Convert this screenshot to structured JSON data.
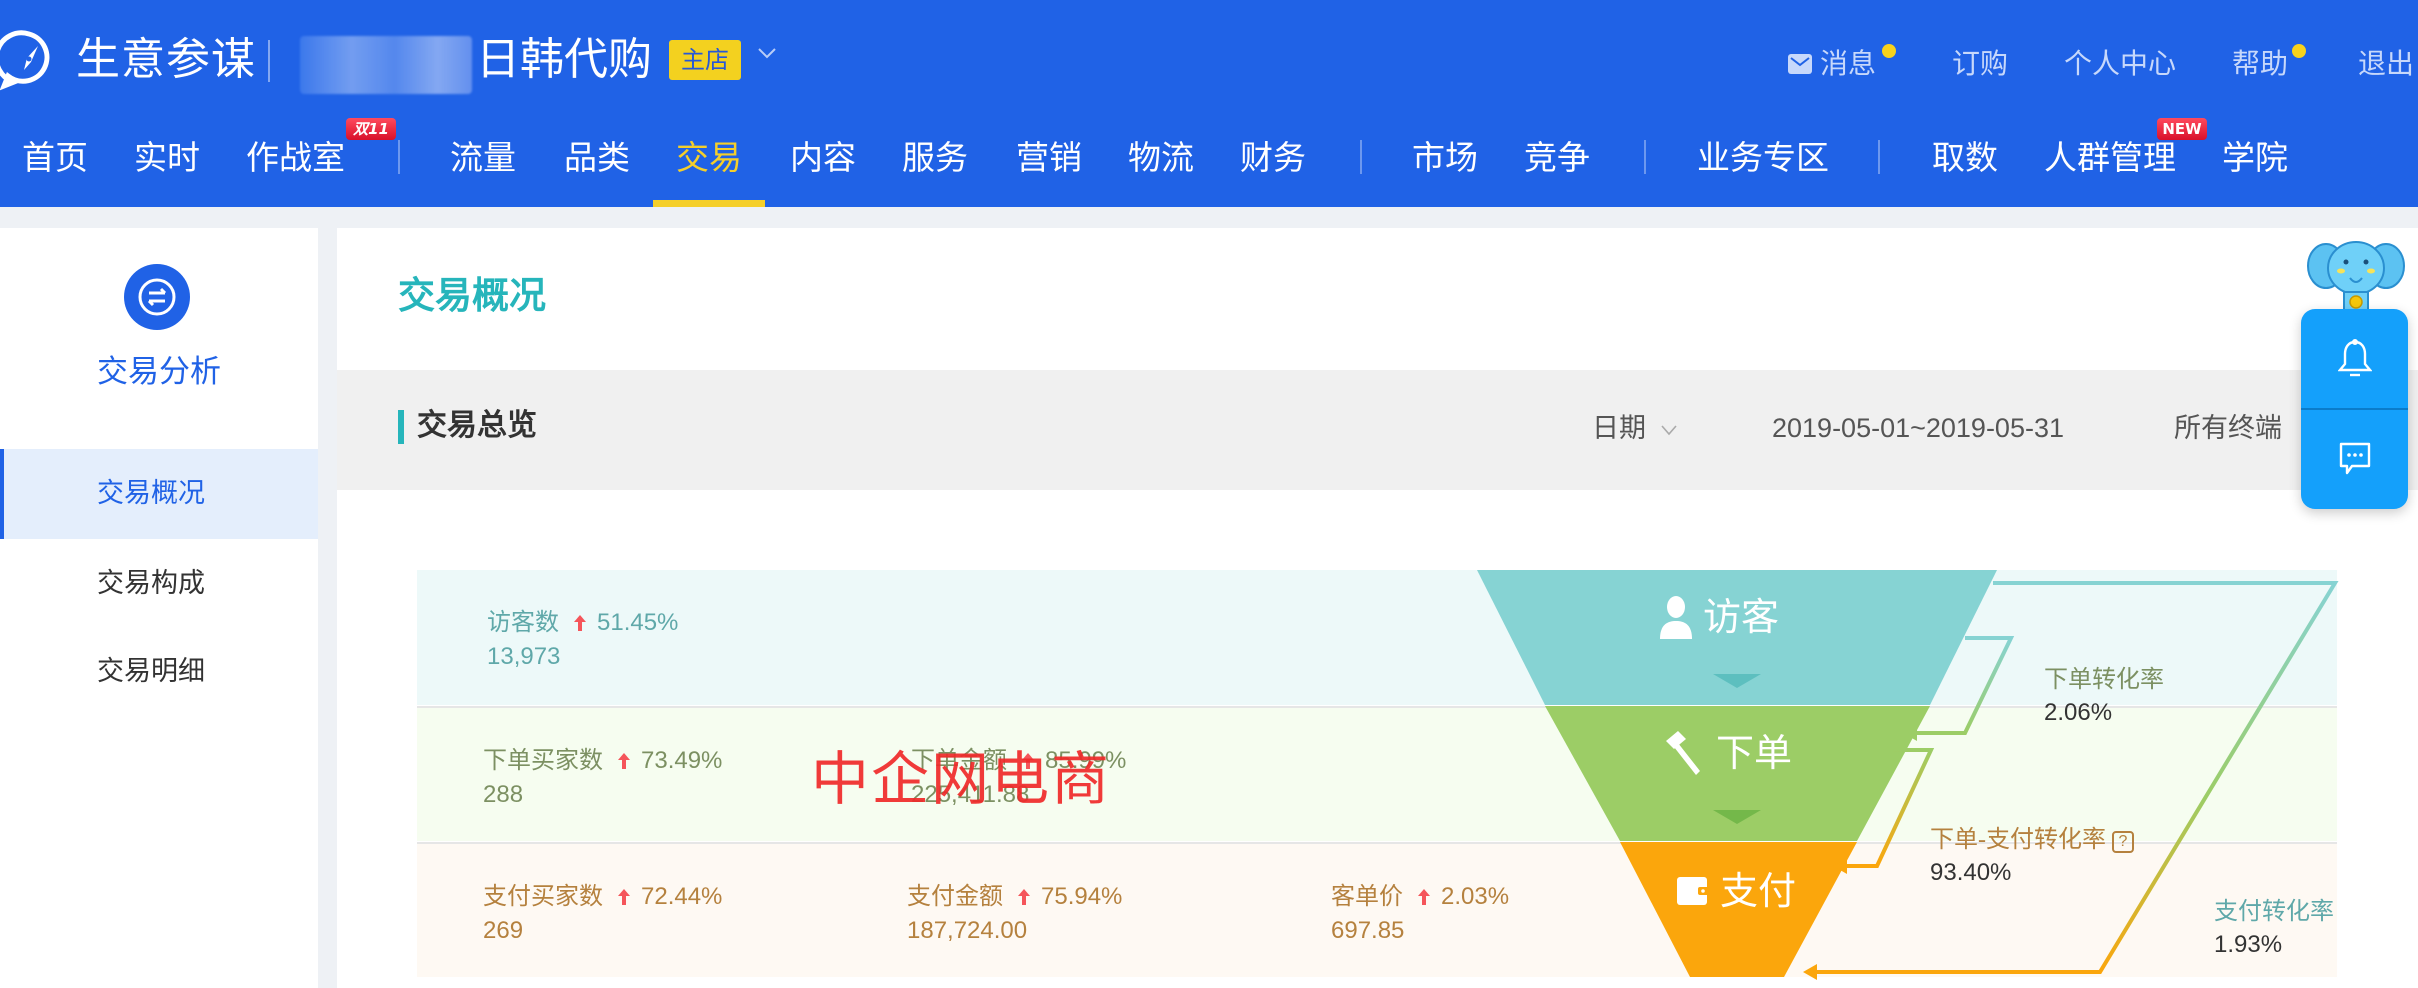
{
  "header": {
    "brand": "生意参谋",
    "shop_name_suffix": "日韩代购",
    "shop_badge": "主店",
    "top_links": [
      {
        "label": "消息",
        "has_dot": true
      },
      {
        "label": "订购",
        "has_dot": false
      },
      {
        "label": "个人中心",
        "has_dot": false
      },
      {
        "label": "帮助",
        "has_dot": true
      },
      {
        "label": "退出",
        "has_dot": false
      }
    ],
    "nav": [
      {
        "label": "首页"
      },
      {
        "label": "实时"
      },
      {
        "label": "作战室",
        "tag": "双11"
      },
      {
        "label": "流量"
      },
      {
        "label": "品类"
      },
      {
        "label": "交易",
        "active": true
      },
      {
        "label": "内容"
      },
      {
        "label": "服务"
      },
      {
        "label": "营销"
      },
      {
        "label": "物流"
      },
      {
        "label": "财务"
      },
      {
        "label": "市场"
      },
      {
        "label": "竞争"
      },
      {
        "label": "业务专区"
      },
      {
        "label": "取数"
      },
      {
        "label": "人群管理",
        "tag": "NEW"
      },
      {
        "label": "学院"
      }
    ],
    "colors": {
      "primary": "#2062e6",
      "active": "#f5cf2a",
      "badge": "#f3d11f"
    }
  },
  "sidebar": {
    "title": "交易分析",
    "items": [
      {
        "label": "交易概况",
        "active": true
      },
      {
        "label": "交易构成",
        "active": false
      },
      {
        "label": "交易明细",
        "active": false
      }
    ]
  },
  "main": {
    "page_title": "交易概况",
    "overview": {
      "title": "交易总览",
      "date_label": "日期",
      "date_range": "2019-05-01~2019-05-31",
      "terminal": "所有终端"
    },
    "funnel": {
      "stages": [
        {
          "name": "访客",
          "color": "#86d3d3"
        },
        {
          "name": "下单",
          "color": "#9ccd66"
        },
        {
          "name": "支付",
          "color": "#fba60c"
        }
      ],
      "rows": [
        {
          "metrics": [
            {
              "label": "访客数",
              "change": "51.45%",
              "value": "13,973"
            }
          ]
        },
        {
          "metrics": [
            {
              "label": "下单买家数",
              "change": "73.49%",
              "value": "288"
            },
            {
              "label": "下单金额",
              "change": "85.99%",
              "value": "225,411.88"
            }
          ]
        },
        {
          "metrics": [
            {
              "label": "支付买家数",
              "change": "72.44%",
              "value": "269"
            },
            {
              "label": "支付金额",
              "change": "75.94%",
              "value": "187,724.00"
            },
            {
              "label": "客单价",
              "change": "2.03%",
              "value": "697.85"
            }
          ]
        }
      ],
      "rates": [
        {
          "label": "下单转化率",
          "value": "2.06%",
          "color": "#7c9062"
        },
        {
          "label": "下单-支付转化率",
          "value": "93.40%",
          "color": "#b5813e",
          "help": "?"
        },
        {
          "label": "支付转化率",
          "value": "1.93%",
          "color": "#5fa8a9"
        }
      ]
    }
  },
  "watermark": "中企网电商",
  "float_panel": {
    "items": [
      {
        "icon": "bell-icon"
      },
      {
        "icon": "chat-icon"
      }
    ]
  }
}
